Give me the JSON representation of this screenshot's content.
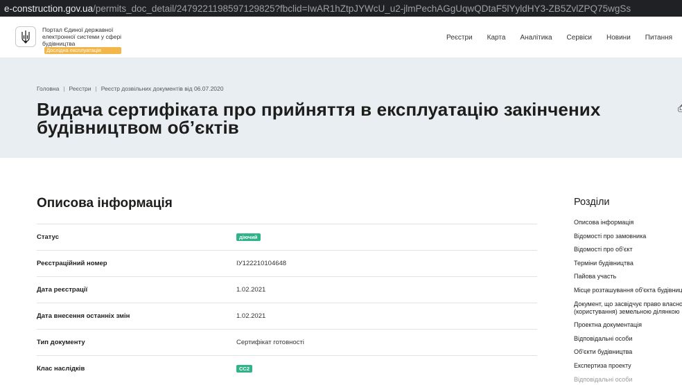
{
  "browser": {
    "url_host": "e-construction.gov.ua",
    "url_path": "/permits_doc_detail/2479221198597129825?fbclid=IwAR1hZtpJYWcU_u2-jlmPechAGgUqwQDtaF5lYyldHY3-ZB5ZvlZPQ75wgSs"
  },
  "header": {
    "portal_line1": "Портал Єдиної державної",
    "portal_line2": "електронної системи у сфері",
    "portal_line3": "будівництва",
    "badge": "Дослідна експлуатація",
    "nav": [
      "Реєстри",
      "Карта",
      "Аналітика",
      "Сервіси",
      "Новини",
      "Питання"
    ]
  },
  "breadcrumbs": [
    "Головна",
    "Реєстри",
    "Реєстр дозвільних документів від 06.07.2020"
  ],
  "page": {
    "title": "Видача сертифіката про прийняття в експлуатацію закінчених будівництвом об’єктів"
  },
  "info": {
    "section_title": "Описова інформація",
    "rows": [
      {
        "label": "Статус",
        "value": "діючий"
      },
      {
        "label": "Реєстраційний номер",
        "value": "ІУ122210104648"
      },
      {
        "label": "Дата реєстрації",
        "value": "1.02.2021"
      },
      {
        "label": "Дата внесення останніх змін",
        "value": "1.02.2021"
      },
      {
        "label": "Тип документу",
        "value": "Сертифікат готовності"
      },
      {
        "label": "Клас наслідків",
        "value": "СС2"
      }
    ]
  },
  "sidebar": {
    "title": "Розділи",
    "items": [
      "Описова інформація",
      "Відомості про замовника",
      "Відомості про об'єкт",
      "Терміни будівництва",
      "Пайова участь",
      "Місце розташування об'єкта будівництва",
      "Документ, що засвідчує право власності",
      "(користування) земельною ділянкою",
      "Проектна документація",
      "Відповідальні особи",
      "Об'єкти будівництва",
      "Експертиза проекту",
      "Відповідальні особи"
    ]
  },
  "colors": {
    "hero_bg": "#e9eef3",
    "status_badge": "#2fb489",
    "experimental_badge": "#f2b64a"
  }
}
